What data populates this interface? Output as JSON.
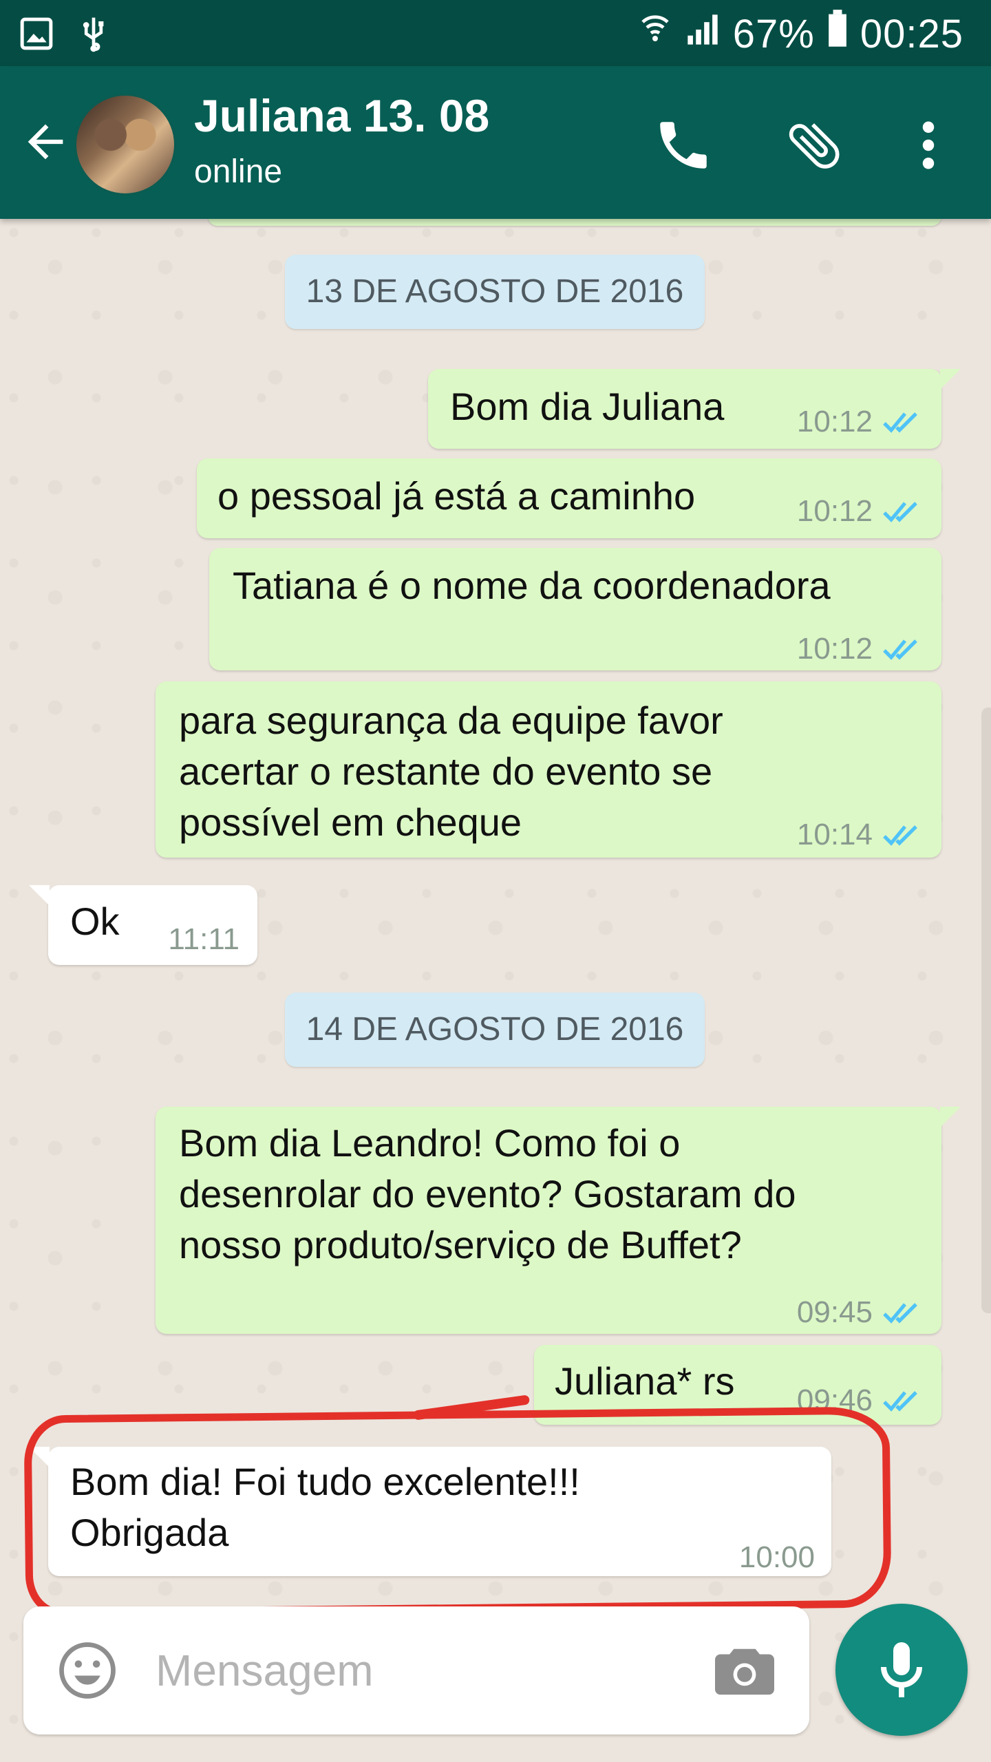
{
  "status_bar": {
    "battery": "67%",
    "time": "00:25",
    "icons": [
      "image-icon",
      "usb-icon",
      "wifi-icon",
      "signal-icon",
      "battery-icon"
    ]
  },
  "header": {
    "contact_name": "Juliana 13. 08",
    "status": "online",
    "actions": [
      "call-icon",
      "attach-icon",
      "more-vert-icon"
    ]
  },
  "chat": {
    "dates": [
      "13 DE AGOSTO DE 2016",
      "14 DE AGOSTO DE 2016"
    ],
    "messages": [
      {
        "direction": "out",
        "text": "Bom dia Juliana",
        "time": "10:12",
        "ticks": "read"
      },
      {
        "direction": "out",
        "text": "o pessoal já está a caminho",
        "time": "10:12",
        "ticks": "read"
      },
      {
        "direction": "out",
        "text": "Tatiana é o nome da coordenadora",
        "time": "10:12",
        "ticks": "read"
      },
      {
        "direction": "out",
        "text": "para segurança da equipe favor\nacertar o restante do evento se\npossível em cheque",
        "time": "10:14",
        "ticks": "read"
      },
      {
        "direction": "in",
        "text": "Ok",
        "time": "11:11"
      },
      {
        "direction": "out",
        "text": "Bom dia Leandro! Como foi o\ndesenrolar do evento? Gostaram do\nnosso produto/serviço de Buffet?",
        "time": "09:45",
        "ticks": "read"
      },
      {
        "direction": "out",
        "text": "Juliana* rs",
        "time": "09:46",
        "ticks": "read"
      },
      {
        "direction": "in",
        "text": "Bom dia! Foi tudo excelente!!!\nObrigada",
        "time": "10:00",
        "highlighted": true
      }
    ]
  },
  "composer": {
    "placeholder": "Mensagem"
  },
  "colors": {
    "status_bar": "#054d44",
    "toolbar": "#075e54",
    "outgoing_bubble": "#dcf8c6",
    "incoming_bubble": "#ffffff",
    "read_ticks": "#4fc3f7",
    "fab": "#128c7e",
    "highlight": "#e3312a"
  }
}
